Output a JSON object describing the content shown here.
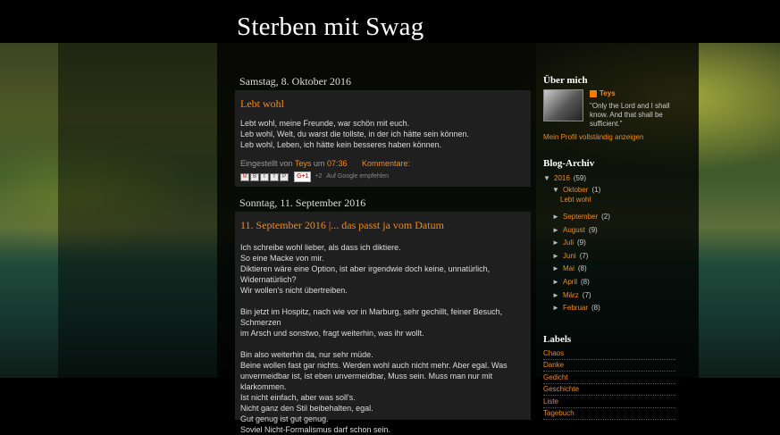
{
  "blog": {
    "title": "Sterben mit Swag"
  },
  "posts": [
    {
      "date": "Samstag, 8. Oktober 2016",
      "title": "Lebt wohl",
      "lines": [
        "Lebt wohl, meine Freunde, war schön mit euch.",
        "Leb wohl, Welt, du warst die tollste, in der ich hätte sein können.",
        "Leb wohl, Leben, ich hätte kein besseres haben können."
      ],
      "posted_by": "Eingestellt von",
      "author": "Teys",
      "at": "um",
      "time": "07:36",
      "comments": "Kommentare:",
      "plus_count": "+2",
      "google_rec": "Auf Google empfehlen",
      "gplus_label": "G+1"
    },
    {
      "date": "Sonntag, 11. September 2016",
      "title": "11. September 2016 |... das passt ja vom Datum",
      "p1": [
        "Ich schreibe wohl lieber, als dass ich diktiere.",
        "So eine Macke von mir.",
        "Diktieren wäre eine Option, ist aber irgendwie doch keine, unnatürlich,",
        "Widernatürlich?",
        "Wir wollen's nicht übertreiben."
      ],
      "p2": [
        "Bin jetzt im Hospitz, nach wie vor in Marburg, sehr gechillt, feiner Besuch, Schmerzen",
        "im Arsch und sonstwo, fragt weiterhin, was ihr wollt."
      ],
      "p3": [
        "Bin also weiterhin da, nur sehr müde.",
        "Beine wollen fast gar nichts. Werden wohl auch nicht mehr. Aber egal. Was",
        "unvermeidbar ist, ist eben unvermeidbar, Muss sein. Muss man nur mit klarkommen.",
        "Ist nicht einfach, aber was soll's.",
        "Nicht ganz den Stil beibehalten, egal.",
        "Gut genug ist gut genug.",
        "Soviel Nicht-Formalismus darf schon sein."
      ]
    }
  ],
  "sidebar": {
    "about_title": "Über mich",
    "profile_name": "Teys",
    "profile_quote": "\"Only the Lord and I shall know. And that shall be sufficient.\"",
    "profile_link": "Mein Profil vollständig anzeigen",
    "archive_title": "Blog-Archiv",
    "archive": {
      "year": "2016",
      "year_count": "(59)",
      "months": [
        {
          "name": "Oktober",
          "count": "(1)",
          "expanded": true
        },
        {
          "name": "September",
          "count": "(2)"
        },
        {
          "name": "August",
          "count": "(9)"
        },
        {
          "name": "Juli",
          "count": "(9)"
        },
        {
          "name": "Juni",
          "count": "(7)"
        },
        {
          "name": "Mai",
          "count": "(8)"
        },
        {
          "name": "April",
          "count": "(8)"
        },
        {
          "name": "März",
          "count": "(7)"
        },
        {
          "name": "Februar",
          "count": "(8)"
        }
      ],
      "open_post": "Lebt wohl",
      "tri_down": "▼",
      "tri_right": "►"
    },
    "labels_title": "Labels",
    "labels": [
      "Chaos",
      "Danke",
      "Gedicht",
      "Geschichte",
      "Liste",
      "Tagebuch"
    ]
  },
  "icons": {
    "gmail": "M",
    "blog": "B",
    "twitter": "t",
    "facebook": "f",
    "pinterest": "P"
  },
  "colors": {
    "accent": "#f18a1d"
  }
}
